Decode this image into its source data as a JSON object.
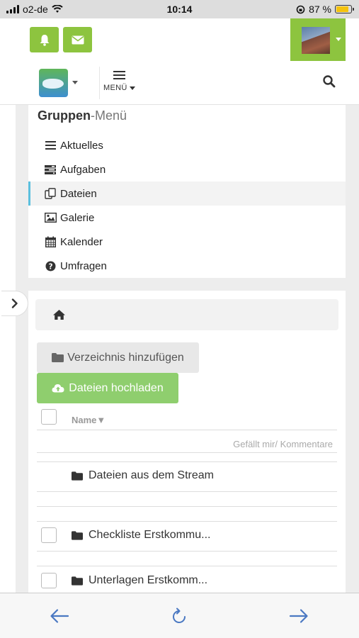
{
  "status_bar": {
    "carrier": "o2-de",
    "time": "10:14",
    "battery_text": "87 %",
    "battery_level": 0.87
  },
  "header": {
    "bell_icon": "bell-icon",
    "mail_icon": "envelope-icon",
    "menu_label": "MENÜ",
    "search_icon": "search-icon"
  },
  "group_menu": {
    "title_bold": "Gruppen",
    "title_rest": "-Menü",
    "items": [
      {
        "label": "Aktuelles",
        "icon": "list-icon",
        "active": false
      },
      {
        "label": "Aufgaben",
        "icon": "tasks-icon",
        "active": false
      },
      {
        "label": "Dateien",
        "icon": "files-icon",
        "active": true
      },
      {
        "label": "Galerie",
        "icon": "image-icon",
        "active": false
      },
      {
        "label": "Kalender",
        "icon": "calendar-icon",
        "active": false
      },
      {
        "label": "Umfragen",
        "icon": "question-icon",
        "active": false
      }
    ]
  },
  "files": {
    "add_directory_label": "Verzeichnis hinzufügen",
    "upload_label": "Dateien hochladen",
    "column_name": "Name▼",
    "column_likes": "Gefällt mir/ Kommentare",
    "rows": [
      {
        "name": "Dateien aus dem Stream",
        "has_checkbox": false
      },
      {
        "name": "Checkliste Erstkommu...",
        "has_checkbox": true
      },
      {
        "name": "Unterlagen Erstkomm...",
        "has_checkbox": true
      }
    ]
  },
  "colors": {
    "accent_green": "#8dc43f",
    "upload_green": "#8fce6e",
    "active_marker": "#5bc0de"
  }
}
